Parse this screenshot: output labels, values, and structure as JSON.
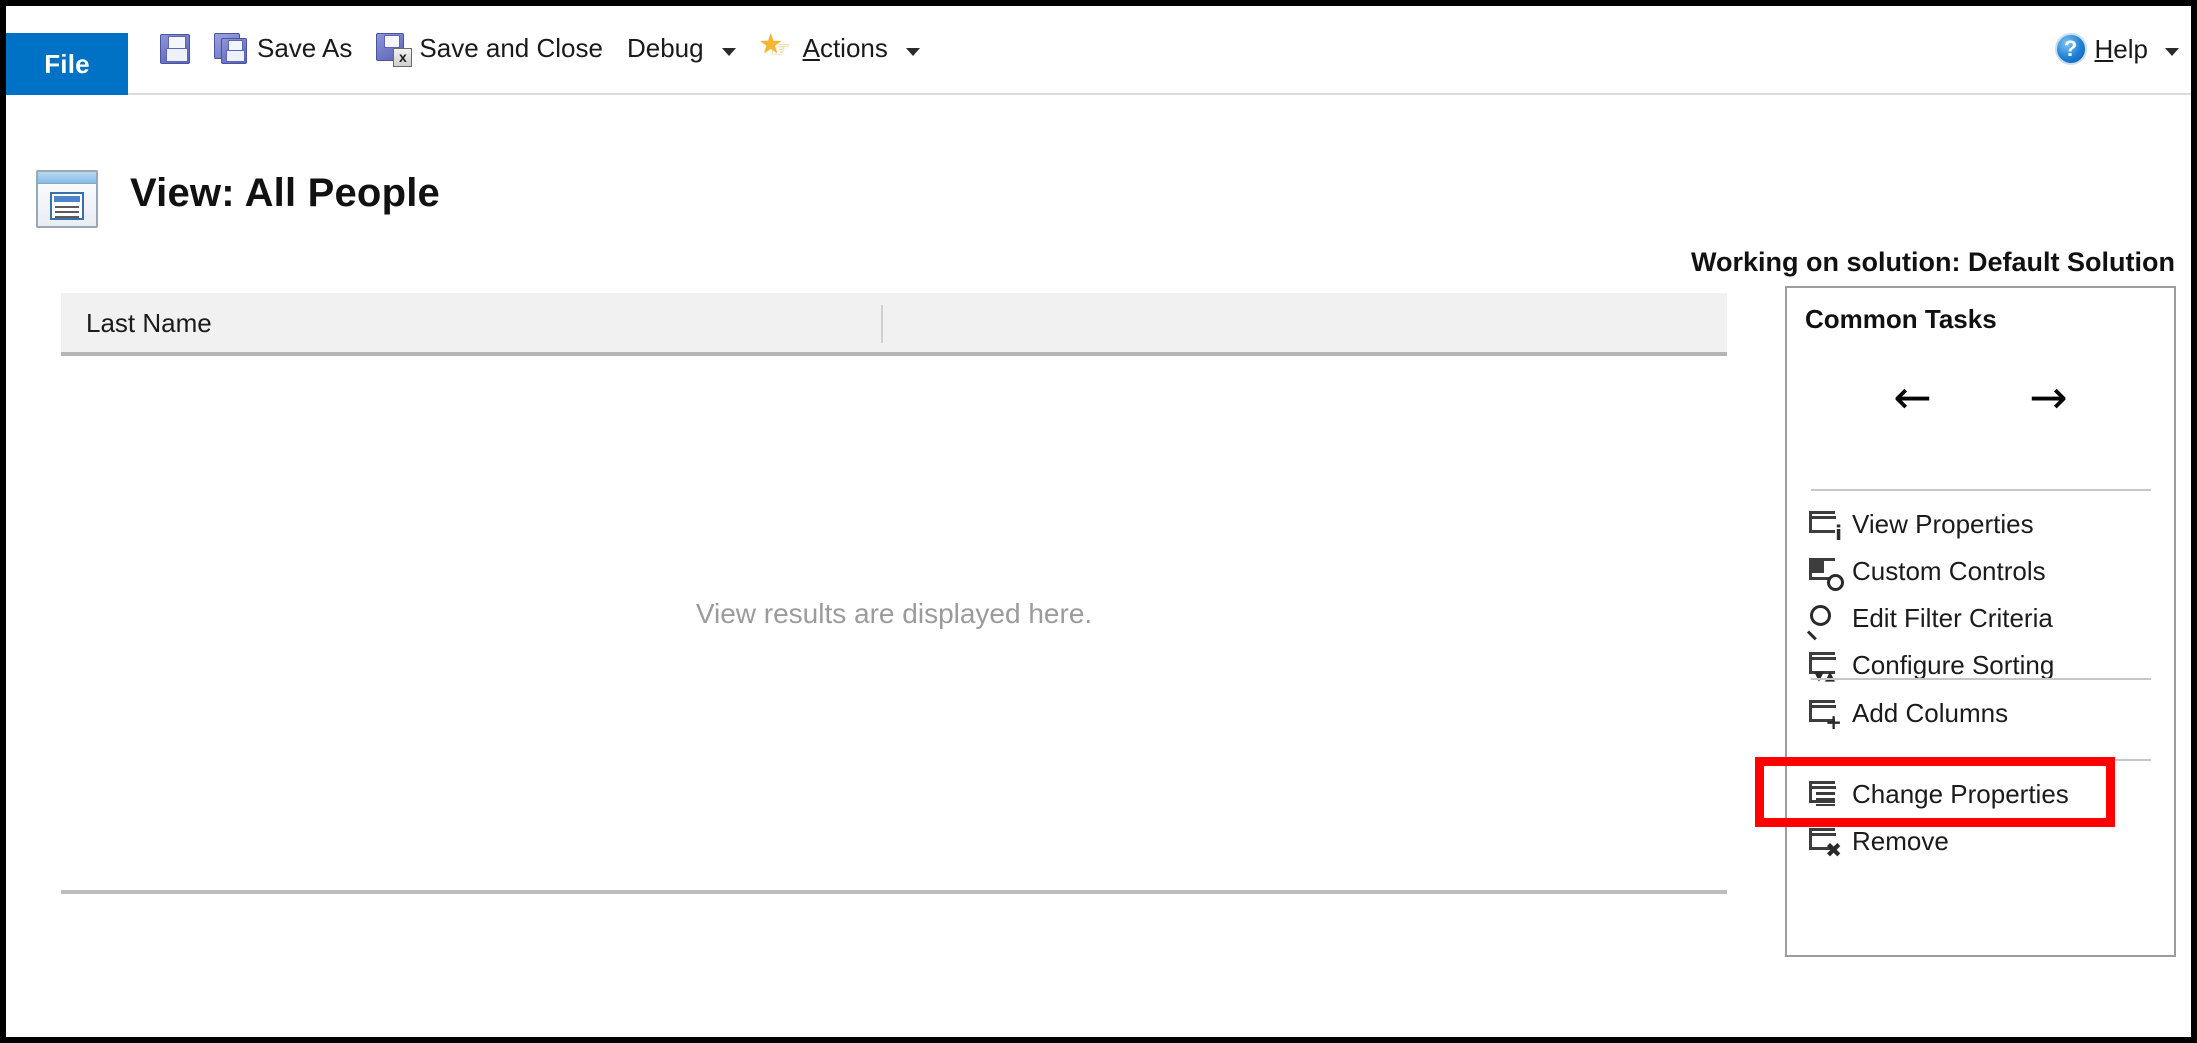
{
  "window": {
    "frame_border_color": "#000000",
    "accent_color": "#0072c6",
    "highlight_color": "#ff0000"
  },
  "ribbon": {
    "file_tab": "File",
    "commands": [
      {
        "label": "",
        "icon": "save-icon"
      },
      {
        "label": "Save As",
        "icon": "save-as-icon"
      },
      {
        "label": "Save and Close",
        "icon": "save-and-close-icon"
      },
      {
        "label": "Debug",
        "icon": "",
        "has_caret": true
      },
      {
        "label": "Actions",
        "icon": "actions-star-icon",
        "has_caret": true
      }
    ],
    "save_label": "",
    "save_as_label": "Save As",
    "save_and_close_label": "Save and Close",
    "debug_label": "Debug",
    "actions_label_prefix": "A",
    "actions_label_rest": "ctions",
    "help_label_prefix": "H",
    "help_label_rest": "elp",
    "help_icon_glyph": "?"
  },
  "header": {
    "view_title": "View: All People",
    "solution_text": "Working on solution: Default Solution"
  },
  "grid": {
    "columns": [
      "Last Name"
    ],
    "column_header_label": "Last Name",
    "empty_message": "View results are displayed here.",
    "rows": []
  },
  "common_tasks": {
    "title": "Common Tasks",
    "nav": {
      "back_arrow": "←",
      "forward_arrow": "→"
    },
    "group_one": [
      {
        "label": "View Properties",
        "icon": "view-properties-icon"
      },
      {
        "label": "Custom Controls",
        "icon": "custom-controls-icon"
      },
      {
        "label": "Edit Filter Criteria",
        "icon": "magnifier-icon"
      },
      {
        "label": "Configure Sorting",
        "icon": "configure-sorting-icon"
      }
    ],
    "group_two": [
      {
        "label": "Add Columns",
        "icon": "add-columns-icon",
        "highlighted": true
      }
    ],
    "group_three": [
      {
        "label": "Change Properties",
        "icon": "change-properties-icon"
      },
      {
        "label": "Remove",
        "icon": "remove-icon"
      }
    ]
  }
}
